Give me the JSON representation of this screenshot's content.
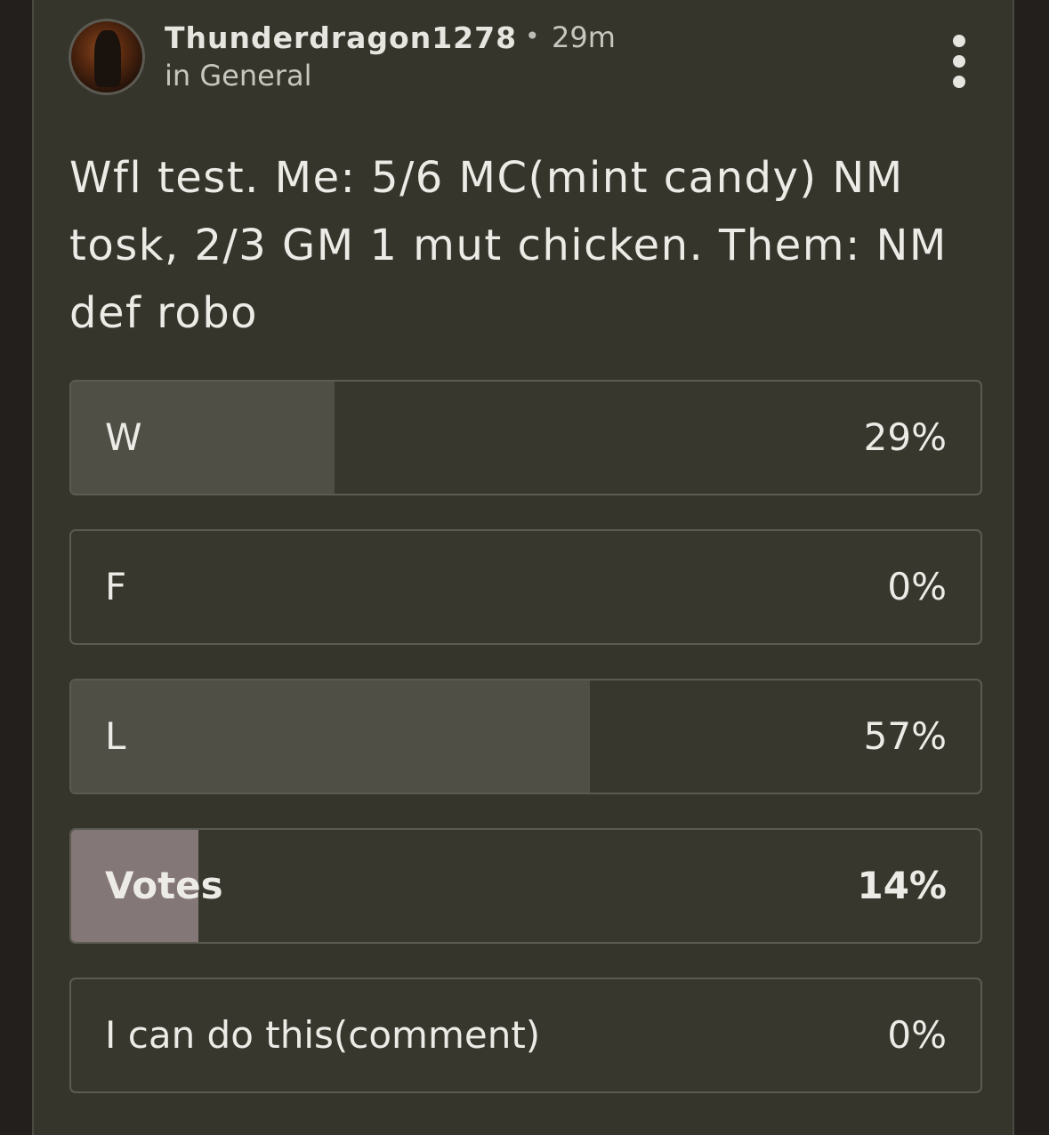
{
  "post": {
    "author": "Thunderdragon1278",
    "separator": "•",
    "time": "29m",
    "community": "in General",
    "avatar_icon": "user-avatar",
    "more_icon": "vertical-ellipsis-icon",
    "text": "Wfl test. Me: 5/6 MC(mint candy) NM tosk, 2/3 GM 1 mut chicken. Them: NM def robo"
  },
  "poll": {
    "options": [
      {
        "label": "W",
        "percent_text": "29%",
        "fraction": 0.29,
        "voted": false
      },
      {
        "label": "F",
        "percent_text": "0%",
        "fraction": 0.0,
        "voted": false
      },
      {
        "label": "L",
        "percent_text": "57%",
        "fraction": 0.57,
        "voted": false
      },
      {
        "label": "Votes",
        "percent_text": "14%",
        "fraction": 0.14,
        "voted": true
      },
      {
        "label": "I can do this(comment)",
        "percent_text": "0%",
        "fraction": 0.0,
        "voted": false
      }
    ]
  },
  "colors": {
    "page_bg": "#221f1d",
    "card_bg": "#35352c",
    "option_fill": "#4f4f45",
    "voted_fill": "#847777",
    "text": "#ecebe6"
  }
}
